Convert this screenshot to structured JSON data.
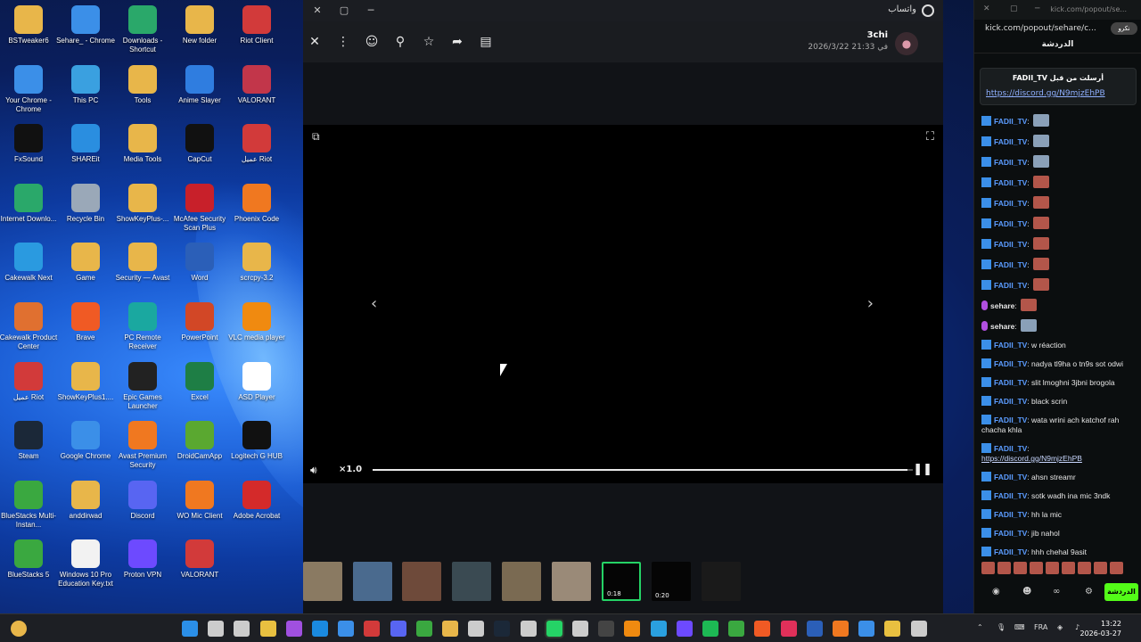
{
  "desktop": {
    "icons": [
      {
        "label": "BSTweaker6",
        "color": "#e8b64a"
      },
      {
        "label": "Sehare_ - Chrome",
        "color": "#3b8fe8"
      },
      {
        "label": "Downloads - Shortcut",
        "color": "#2aa86a"
      },
      {
        "label": "New folder",
        "color": "#e8b64a"
      },
      {
        "label": "Riot Client",
        "color": "#d23a3a"
      },
      {
        "label": "Your Chrome - Chrome",
        "color": "#3b8fe8"
      },
      {
        "label": "This PC",
        "color": "#3aa0e0"
      },
      {
        "label": "Tools",
        "color": "#e8b64a"
      },
      {
        "label": "Anime Slayer",
        "color": "#2f7de0"
      },
      {
        "label": "VALORANT",
        "color": "#c2364a"
      },
      {
        "label": "FxSound",
        "color": "#111111"
      },
      {
        "label": "SHAREit",
        "color": "#2a8ee0"
      },
      {
        "label": "Media Tools",
        "color": "#e8b64a"
      },
      {
        "label": "CapCut",
        "color": "#111111"
      },
      {
        "label": "عميل Riot",
        "color": "#d23a3a"
      },
      {
        "label": "Internet Downlo...",
        "color": "#2aa86a"
      },
      {
        "label": "Recycle Bin",
        "color": "#9aa8b8"
      },
      {
        "label": "ShowKeyPlus-...",
        "color": "#e8b64a"
      },
      {
        "label": "McAfee Security Scan Plus",
        "color": "#c8202a"
      },
      {
        "label": "Phoenix Code",
        "color": "#f07820"
      },
      {
        "label": "Cakewalk Next",
        "color": "#2a9ae0"
      },
      {
        "label": "Game",
        "color": "#e8b64a"
      },
      {
        "label": "Security — Avast",
        "color": "#e8b64a"
      },
      {
        "label": "Word",
        "color": "#2b5fb8"
      },
      {
        "label": "scrcpy-3.2",
        "color": "#e8b64a"
      },
      {
        "label": "Cakewalk Product Center",
        "color": "#e07030"
      },
      {
        "label": "Brave",
        "color": "#f05a24"
      },
      {
        "label": "PC Remote Receiver",
        "color": "#1aa8a0"
      },
      {
        "label": "PowerPoint",
        "color": "#d24726"
      },
      {
        "label": "VLC media player",
        "color": "#f08a10"
      },
      {
        "label": "عميل Riot",
        "color": "#d23a3a"
      },
      {
        "label": "ShowKeyPlus1....",
        "color": "#e8b64a"
      },
      {
        "label": "Epic Games Launcher",
        "color": "#222222"
      },
      {
        "label": "Excel",
        "color": "#1e7e45"
      },
      {
        "label": "ASD Player",
        "color": "#ffffff"
      },
      {
        "label": "Steam",
        "color": "#1b2838"
      },
      {
        "label": "Google Chrome",
        "color": "#3b8fe8"
      },
      {
        "label": "Avast Premium Security",
        "color": "#f07820"
      },
      {
        "label": "DroidCamApp",
        "color": "#5aa830"
      },
      {
        "label": "Logitech G HUB",
        "color": "#111111"
      },
      {
        "label": "BlueStacks Multi-Instan...",
        "color": "#3aa840"
      },
      {
        "label": "anddirwad",
        "color": "#e8b64a"
      },
      {
        "label": "Discord",
        "color": "#5865f2"
      },
      {
        "label": "WO Mic Client",
        "color": "#f07820"
      },
      {
        "label": "Adobe Acrobat",
        "color": "#d42a2a"
      },
      {
        "label": "BlueStacks 5",
        "color": "#3aa840"
      },
      {
        "label": "Windows 10 Pro Education Key.txt",
        "color": "#f2f2f2"
      },
      {
        "label": "Proton VPN",
        "color": "#6d4aff"
      },
      {
        "label": "VALORANT",
        "color": "#d23a3a"
      }
    ]
  },
  "whatsapp": {
    "app_name": "واتساب",
    "sender_name": "3chi",
    "sender_time": "2026/3/22 في 21:33",
    "speed": "×1.0",
    "progress": 0.99,
    "thumbnails": [
      {
        "color": "#8a7a62",
        "duration": ""
      },
      {
        "color": "#4a6a8e",
        "duration": ""
      },
      {
        "color": "#6e4a3a",
        "duration": ""
      },
      {
        "color": "#3a4a52",
        "duration": ""
      },
      {
        "color": "#7a6a52",
        "duration": ""
      },
      {
        "color": "#9a8a78",
        "duration": ""
      },
      {
        "color": "#050505",
        "duration": "0:18"
      },
      {
        "color": "#050505",
        "duration": "0:20"
      },
      {
        "color": "#1a1a1a",
        "duration": ""
      }
    ]
  },
  "kick": {
    "url": "kick.com/popout/sehare/c...",
    "popout_url": "kick.com/popout/se...",
    "tab": "الدردشة",
    "pill": "نكرو",
    "pinned_header": "FADII_TV أرسلت من قبل",
    "pinned_link": "https://discord.gg/N9mjzEhPB",
    "messages": [
      {
        "user": "FADII_TV",
        "badge": "blue",
        "text": "",
        "emote": "stone"
      },
      {
        "user": "FADII_TV",
        "badge": "blue",
        "text": "",
        "emote": "stone"
      },
      {
        "user": "FADII_TV",
        "badge": "blue",
        "text": "",
        "emote": "stone"
      },
      {
        "user": "FADII_TV",
        "badge": "blue",
        "text": "",
        "emote": "face"
      },
      {
        "user": "FADII_TV",
        "badge": "blue",
        "text": "",
        "emote": "face"
      },
      {
        "user": "FADII_TV",
        "badge": "blue",
        "text": "",
        "emote": "face"
      },
      {
        "user": "FADII_TV",
        "badge": "blue",
        "text": "",
        "emote": "face"
      },
      {
        "user": "FADII_TV",
        "badge": "blue",
        "text": "",
        "emote": "face"
      },
      {
        "user": "FADII_TV",
        "badge": "blue",
        "text": "",
        "emote": "face"
      },
      {
        "user": "sehare",
        "badge": "mic",
        "text": "",
        "emote": "face"
      },
      {
        "user": "sehare",
        "badge": "mic",
        "text": "",
        "emote": "stone"
      },
      {
        "user": "FADII_TV",
        "badge": "blue",
        "text": "w réaction",
        "emote": ""
      },
      {
        "user": "FADII_TV",
        "badge": "blue",
        "text": "nadya tl9ha o tn9s sot odwi",
        "emote": ""
      },
      {
        "user": "FADII_TV",
        "badge": "blue",
        "text": "slit lmoghni 3jbni brogola",
        "emote": ""
      },
      {
        "user": "FADII_TV",
        "badge": "blue",
        "text": "black scrin",
        "emote": ""
      },
      {
        "user": "FADII_TV",
        "badge": "blue",
        "text": "wata wrini ach katchof rah chacha khla",
        "emote": ""
      },
      {
        "user": "FADII_TV",
        "badge": "blue",
        "text": "",
        "emote": "",
        "link": "https://discord.gg/N9mjzEhPB"
      },
      {
        "user": "FADII_TV",
        "badge": "blue",
        "text": "ahsn streamr",
        "emote": ""
      },
      {
        "user": "FADII_TV",
        "badge": "blue",
        "text": "sotk wadh ina mic 3ndk",
        "emote": ""
      },
      {
        "user": "FADII_TV",
        "badge": "blue",
        "text": "hh la mic",
        "emote": ""
      },
      {
        "user": "FADII_TV",
        "badge": "blue",
        "text": "jib nahol",
        "emote": ""
      },
      {
        "user": "FADII_TV",
        "badge": "blue",
        "text": "hhh chehal 9asit",
        "emote": ""
      }
    ],
    "send_label": "الدردشة"
  },
  "taskbar": {
    "lang": "FRA",
    "time": "13:22",
    "date": "2026-03-27",
    "icons": [
      "#2b8fe8",
      "#cccccc",
      "#cccccc",
      "#e8c040",
      "#a050e0",
      "#1a8ae0",
      "#3b8fe8",
      "#d23a3a",
      "#5865f2",
      "#3aa840",
      "#e8b64a",
      "#cccccc",
      "#1b2838",
      "#cccccc",
      "#25d366",
      "#cccccc",
      "#444444",
      "#f08a10",
      "#2aa0e0",
      "#6d4aff",
      "#1db954",
      "#3aa840",
      "#f05a24",
      "#e0305a",
      "#2b5fb8",
      "#f07820",
      "#3b8fe8",
      "#e8c040",
      "#cccccc"
    ]
  }
}
